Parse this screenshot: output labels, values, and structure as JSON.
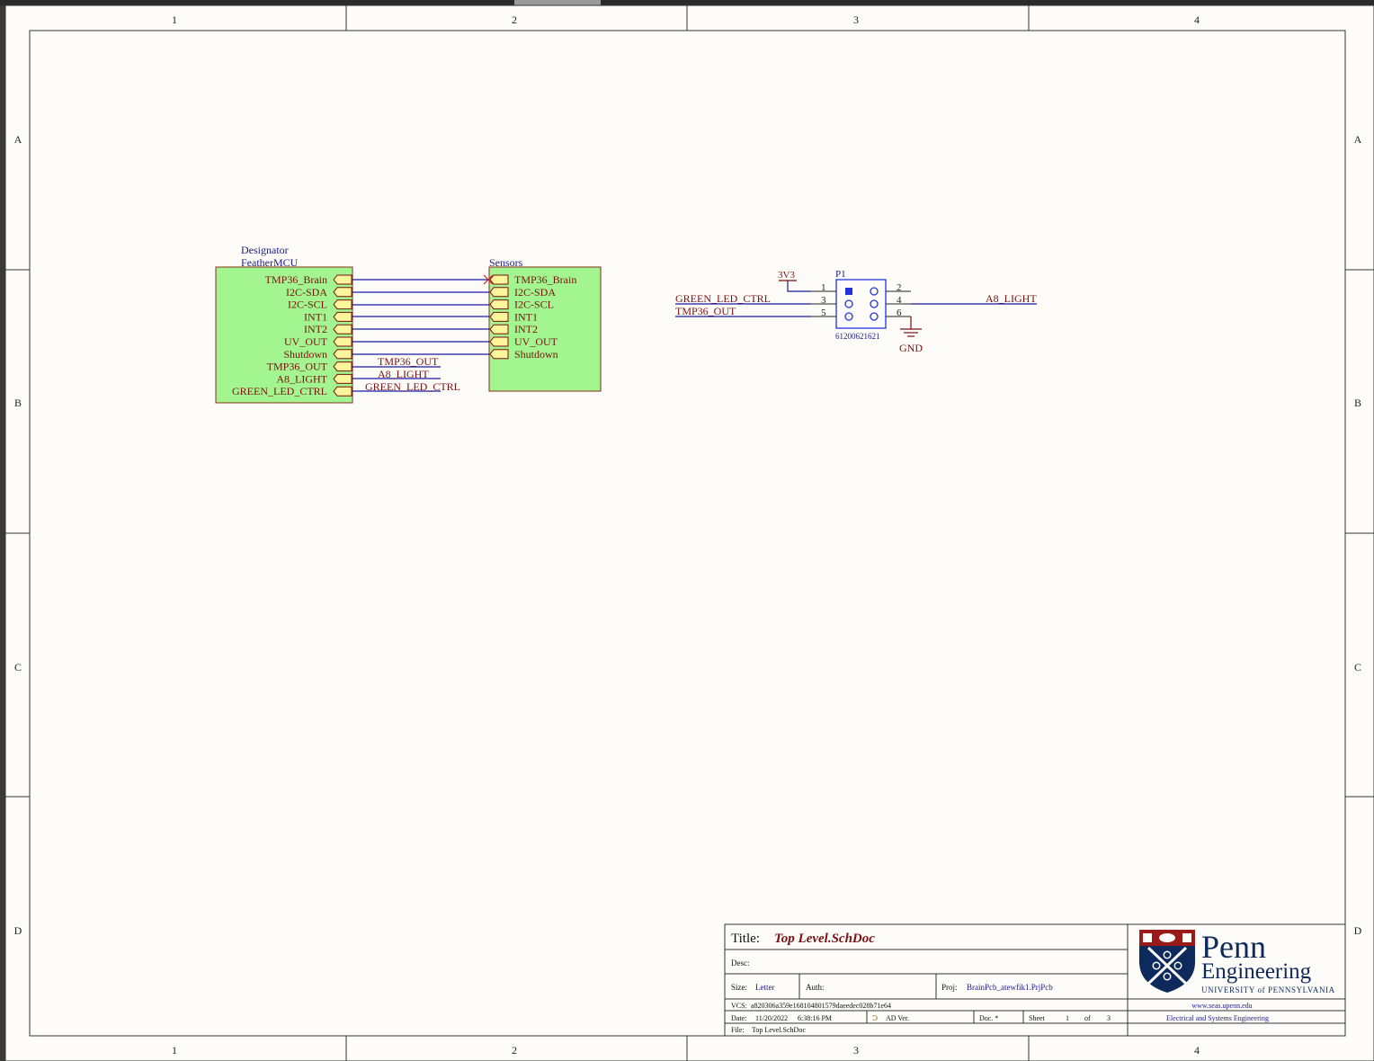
{
  "sheet": {
    "columns": [
      "1",
      "2",
      "3",
      "4"
    ],
    "rows": [
      "A",
      "B",
      "C",
      "D"
    ]
  },
  "colors": {
    "paper": "#fdfcf9",
    "frame": "#333333",
    "block_fill": "#a2f58f",
    "block_border": "#8b2a1a",
    "port_fill": "#fff59a",
    "wire": "#1a1aa8",
    "net_label": "#7a1010",
    "pin_text": "#7a1010",
    "designator": "#1a1a8a",
    "title_red": "#7a1010"
  },
  "feather_block": {
    "designator_label": "Designator",
    "name": "FeatherMCU",
    "ports": [
      "TMP36_Brain",
      "I2C-SDA",
      "I2C-SCL",
      "INT1",
      "INT2",
      "UV_OUT",
      "Shutdown",
      "TMP36_OUT",
      "A8_LIGHT",
      "GREEN_LED_CTRL"
    ]
  },
  "sensors_block": {
    "name": "Sensors",
    "ports": [
      "TMP36_Brain",
      "I2C-SDA",
      "I2C-SCL",
      "INT1",
      "INT2",
      "UV_OUT",
      "Shutdown"
    ]
  },
  "net_labels_left": [
    "TMP36_OUT",
    "A8_LIGHT",
    "GREEN_LED_CTRL"
  ],
  "connector": {
    "designator": "P1",
    "part": "61200621621",
    "pins": [
      "1",
      "2",
      "3",
      "4",
      "5",
      "6"
    ],
    "power": "3V3",
    "ground": "GND",
    "net_green": "GREEN_LED_CTRL",
    "net_tmp": "TMP36_OUT",
    "net_light": "A8_LIGHT"
  },
  "title_block": {
    "title_label": "Title:",
    "title": "Top Level.SchDoc",
    "desc_label": "Desc:",
    "size_label": "Size:",
    "size": "Letter",
    "auth_label": "Auth:",
    "proj_label": "Proj:",
    "proj": "BrainPcb_atewfik1.PrjPcb",
    "vcs_label": "VCS:",
    "vcs": "a820306a359e168104801579daeedec028b71e64",
    "date_label": "Date:",
    "date": "11/20/2022",
    "time": "6:38:16 PM",
    "ad_ver": "AD Ver.",
    "doc": "Doc. *",
    "sheet_label": "Sheet",
    "sheet_num": "1",
    "of_label": "of",
    "sheet_total": "3",
    "file_label": "File:",
    "file": "Top Level.SchDoc",
    "logo_penn": "Penn",
    "logo_engineering": "Engineering",
    "logo_university": "UNIVERSITY of PENNSYLVANIA",
    "website": "www.seas.upenn.edu",
    "department": "Electrical and Systems Engineering"
  }
}
